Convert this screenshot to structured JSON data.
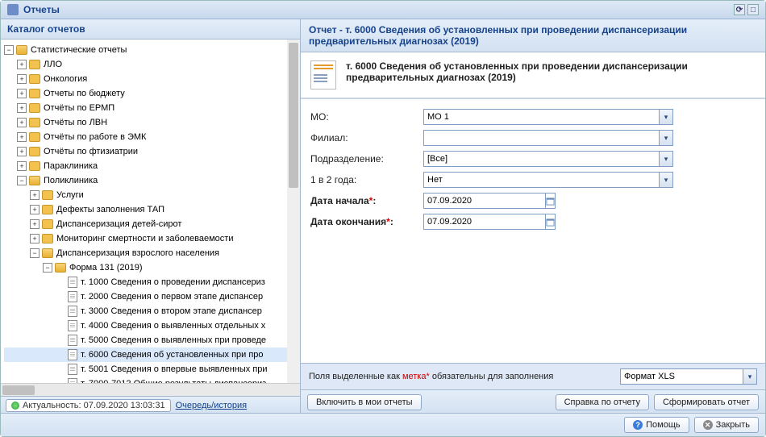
{
  "window": {
    "title": "Отчеты"
  },
  "catalog": {
    "title": "Каталог отчетов",
    "root": "Статистические отчеты",
    "items": [
      "ЛЛО",
      "Онкология",
      "Отчеты по бюджету",
      "Отчёты по ЕРМП",
      "Отчёты по ЛВН",
      "Отчёты по работе в ЭМК",
      "Отчёты по фтизиатрии",
      "Параклиника"
    ],
    "poli": "Поликлиника",
    "poli_children": [
      "Услуги",
      "Дефекты заполнения ТАП",
      "Диспансеризация детей-сирот",
      "Мониторинг смертности и заболеваемости"
    ],
    "dvn": "Диспансеризация взрослого населения",
    "forma": "Форма 131 (2019)",
    "reports": [
      "т. 1000 Сведения о проведении диспансериз",
      "т. 2000 Сведения о первом этапе диспансер",
      "т. 3000 Сведения о втором этапе диспансер",
      "т. 4000 Сведения о выявленных отдельных х",
      "т. 5000 Сведения о выявленных при проведе",
      "т. 6000 Сведения об установленных при про",
      "т. 5001 Сведения о впервые выявленных при",
      "т. 7000-7012 Общие результаты диспансериз"
    ],
    "selected_index": 5
  },
  "status": {
    "text": "Актуальность: 07.09.2020 13:03:31",
    "queue": "Очередь/история"
  },
  "report": {
    "panel_title": "Отчет - т. 6000 Сведения об установленных при проведении диспансеризации предварительных диагнозах (2019)",
    "name": "т. 6000 Сведения об установленных при проведении диспансеризации предварительных диагнозах (2019)",
    "fields": {
      "mo_label": "МО:",
      "mo_value": "МО 1",
      "filial_label": "Филиал:",
      "filial_value": "",
      "dept_label": "Подразделение:",
      "dept_value": "[Все]",
      "oneintwo_label": "1 в 2 года:",
      "oneintwo_value": "Нет",
      "start_label": "Дата начала",
      "start_value": "07.09.2020",
      "end_label": "Дата окончания",
      "end_value": "07.09.2020"
    },
    "note_pre": "Поля выделенные как ",
    "note_mark": "метка*",
    "note_post": " обязательны для заполнения",
    "format_value": "Формат XLS"
  },
  "buttons": {
    "include": "Включить в мои отчеты",
    "help_report": "Справка по отчету",
    "generate": "Сформировать отчет",
    "help": "Помощь",
    "close": "Закрыть"
  }
}
